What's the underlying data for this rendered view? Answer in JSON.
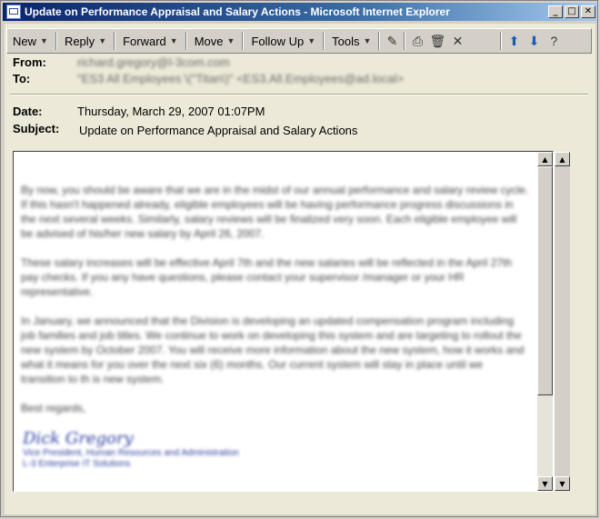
{
  "window": {
    "title": "Update on Performance Appraisal and Salary Actions - Microsoft Internet Explorer"
  },
  "toolbar": {
    "new": "New",
    "reply": "Reply",
    "forward": "Forward",
    "move": "Move",
    "follow_up": "Follow Up",
    "tools": "Tools"
  },
  "header": {
    "from_label": "From:",
    "from_value": "richard.gregory@l-3com.com",
    "to_label": "To:",
    "to_value": "\"ES3 All Employees \\(\"Titan\\)\" <ES3.All.Employees@ad.local>",
    "date_label": "Date:",
    "date_value": "Thursday, March 29, 2007 01:07PM",
    "subject_label": "Subject:",
    "subject_value": "Update on Performance Appraisal and Salary Actions"
  },
  "message": {
    "p1": "By now, you should be aware that we are in the midst of our annual performance and salary review cycle. If this hasn't happened already, eligible employees will be having performance progress discussions in the next several weeks. Similarly, salary reviews will be finalized very soon. Each eligible employee will be advised of his/her new salary by April 26, 2007.",
    "p2": "These salary increases will be effective April 7th and the new salaries will be reflected in the April 27th pay checks. If you any have questions, please contact your supervisor /manager or your HR representative.",
    "p3": "In January, we announced that the Division is developing an updated compensation program including job families and job titles. We continue to work on developing this system and are targeting to rollout the new system by October 2007. You will receive more information about the new system, how it works and what it means for you over the next six (6) months. Our current system will stay in place until we transition to th is new system.",
    "closing": "Best regards,",
    "sig_name": "Dick Gregory",
    "sig_title": "Vice President, Human Resources and Administration",
    "sig_company": "L-3 Enterprise IT Solutions"
  },
  "colors": {
    "titlebar": "#0a246a",
    "chrome": "#d4d0c8",
    "signature": "#3040a0"
  }
}
